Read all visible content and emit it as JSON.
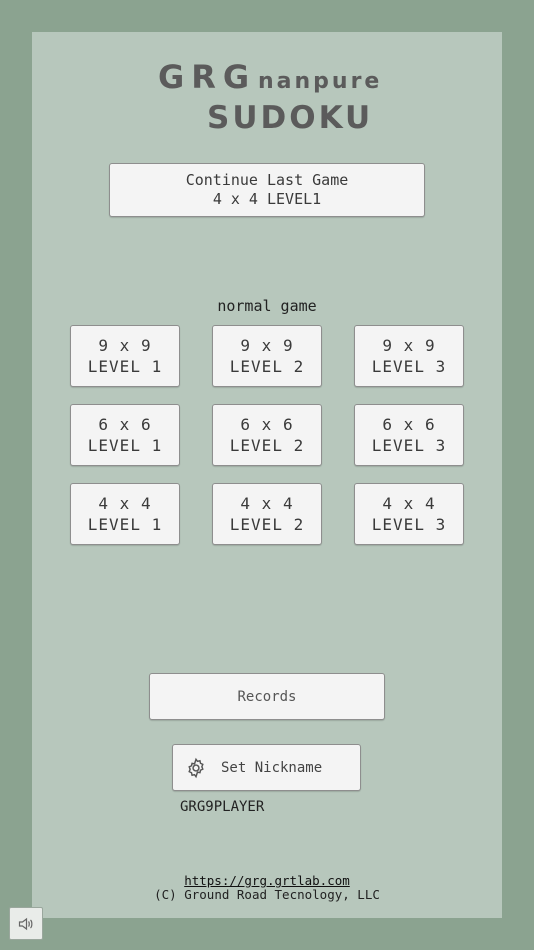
{
  "logo": {
    "line1": "GRG",
    "line1_sub": "nanpure",
    "line2": "SUDOKU"
  },
  "continue_button": {
    "line1": "Continue Last Game",
    "line2": "4 x 4 LEVEL1"
  },
  "normal_game": {
    "title": "normal game",
    "buttons": [
      {
        "size": "9 x 9",
        "level": "LEVEL 1"
      },
      {
        "size": "9 x 9",
        "level": "LEVEL 2"
      },
      {
        "size": "9 x 9",
        "level": "LEVEL 3"
      },
      {
        "size": "6 x 6",
        "level": "LEVEL 1"
      },
      {
        "size": "6 x 6",
        "level": "LEVEL 2"
      },
      {
        "size": "6 x 6",
        "level": "LEVEL 3"
      },
      {
        "size": "4 x 4",
        "level": "LEVEL 1"
      },
      {
        "size": "4 x 4",
        "level": "LEVEL 2"
      },
      {
        "size": "4 x 4",
        "level": "LEVEL 3"
      }
    ]
  },
  "records_button": {
    "label": "Records"
  },
  "nickname_button": {
    "label": "Set Nickname",
    "icon": "gear-icon"
  },
  "nickname_value": "GRG9PLAYER",
  "footer": {
    "link": "https://grg.grtlab.com",
    "copyright": "(C) Ground Road Tecnology, LLC"
  },
  "sound_button": {
    "icon": "speaker-icon"
  },
  "colors": {
    "background": "#8ba390",
    "panel": "#b7c7bc",
    "button": "#f4f4f4",
    "logo": "#5b5b5b"
  }
}
